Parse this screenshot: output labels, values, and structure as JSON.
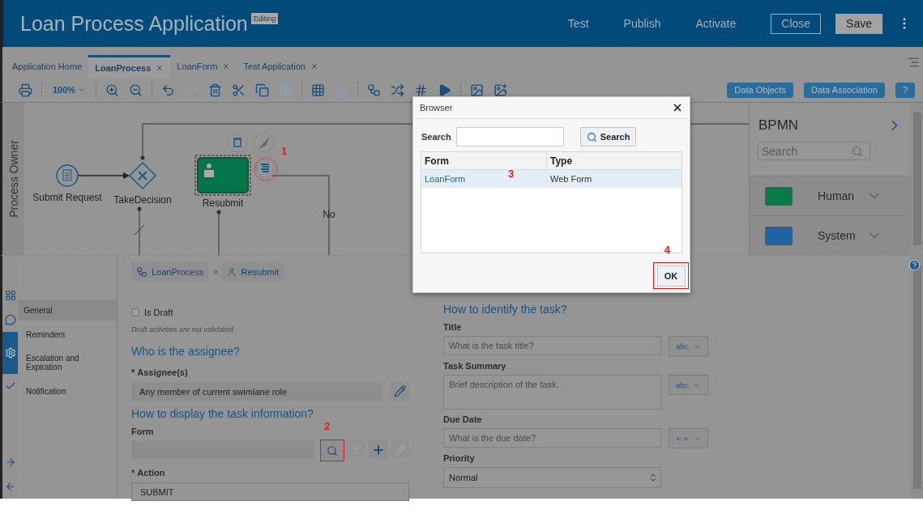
{
  "header": {
    "title": "Loan Process Application",
    "badge": "Editing",
    "actions": [
      "Test",
      "Publish",
      "Activate"
    ],
    "buttons": [
      {
        "label": "Close",
        "kind": "outline"
      },
      {
        "label": "Save",
        "kind": "filled"
      }
    ]
  },
  "tabs": [
    {
      "label": "Application Home",
      "selected": false,
      "closable": false
    },
    {
      "label": "LoanProcess",
      "selected": true,
      "closable": true
    },
    {
      "label": "LoanForm",
      "selected": false,
      "closable": true
    },
    {
      "label": "Test Application",
      "selected": false,
      "closable": true
    }
  ],
  "required_mark": "*",
  "toolbar": {
    "zoom": "100%",
    "tools": [
      {
        "kind": "print",
        "disabled": false
      },
      {
        "kind": "sep"
      },
      {
        "kind": "zoom"
      },
      {
        "kind": "sep"
      },
      {
        "kind": "zoom-in",
        "disabled": false
      },
      {
        "kind": "zoom-out",
        "disabled": false
      },
      {
        "kind": "sep"
      },
      {
        "kind": "undo",
        "disabled": false
      },
      {
        "kind": "redo",
        "disabled": true
      },
      {
        "kind": "delete",
        "disabled": false
      },
      {
        "kind": "cut",
        "disabled": false
      },
      {
        "kind": "copy",
        "disabled": false
      },
      {
        "kind": "paste",
        "disabled": true
      },
      {
        "kind": "sep"
      },
      {
        "kind": "grid",
        "disabled": false
      },
      {
        "kind": "lock",
        "disabled": true
      },
      {
        "kind": "sep"
      },
      {
        "kind": "flow",
        "disabled": false
      },
      {
        "kind": "shuffle",
        "disabled": false
      },
      {
        "kind": "hash",
        "disabled": false
      },
      {
        "kind": "play",
        "disabled": false
      },
      {
        "kind": "sep"
      },
      {
        "kind": "image",
        "disabled": false
      },
      {
        "kind": "image-edit",
        "disabled": false
      }
    ],
    "buttons": [
      "Data Objects",
      "Data Association",
      "?"
    ]
  },
  "diagram": {
    "lane": "Process Owner",
    "nodes": [
      {
        "kind": "start",
        "label": "Submit Request",
        "selected": false
      },
      {
        "kind": "gateway",
        "label": "TakeDecision",
        "selected": false
      },
      {
        "kind": "task",
        "label": "Resubmit",
        "selected": true
      }
    ],
    "flow_label": "No",
    "annotation": "1"
  },
  "palette": {
    "title": "BPMN",
    "search_placeholder": "Search",
    "items": [
      {
        "label": "Human",
        "color": "#0b7a4b"
      },
      {
        "label": "System",
        "color": "#1c64a6"
      }
    ]
  },
  "side_icons": [
    {
      "kind": "grid",
      "selected": false
    },
    {
      "kind": "chat",
      "selected": false
    },
    {
      "kind": "gear",
      "selected": true
    },
    {
      "kind": "check",
      "selected": false
    },
    {
      "kind": "gap"
    },
    {
      "kind": "arrow-right",
      "selected": false
    },
    {
      "kind": "arrow-left",
      "selected": false
    }
  ],
  "nav": [
    {
      "label": "General",
      "selected": true
    },
    {
      "label": "Reminders",
      "selected": false
    },
    {
      "label": "Escalation and Expiration",
      "selected": false
    },
    {
      "label": "Notification",
      "selected": false
    }
  ],
  "breadcrumb": [
    {
      "label": "LoanProcess",
      "kind": "process"
    },
    {
      "label": "Resubmit",
      "kind": "task"
    }
  ],
  "breadcrumb_separator": ">",
  "assign": {
    "draft": {
      "label": "Is Draft",
      "checked": false
    },
    "draft_note": "Draft activities are not validated.",
    "assignee_heading": "Who is the assignee?",
    "assignee_label": "Assignee(s)",
    "assignee_value": "Any member of current swimlane role",
    "display_heading": "How to display the task information?",
    "form_label": "Form",
    "form_annotation": "2",
    "action_label": "Action",
    "action_value": "SUBMIT"
  },
  "identify": {
    "heading": "How to identify the task?",
    "fields": [
      {
        "label": "Title",
        "kind": "text",
        "placeholder": "What is the task title?",
        "mode": {
          "kind": "text",
          "label": "abc"
        }
      },
      {
        "label": "Task Summary",
        "kind": "textarea",
        "placeholder": "Brief description of the task.",
        "mode": {
          "kind": "text",
          "label": "abc"
        }
      },
      {
        "label": "Due Date",
        "kind": "text",
        "placeholder": "What is the due date?",
        "mode": {
          "kind": "expression"
        }
      },
      {
        "label": "Priority",
        "kind": "select",
        "value": "Normal"
      }
    ]
  },
  "dialog": {
    "title": "Browser",
    "search_label": "Search",
    "search_button": "Search",
    "columns": [
      "Form",
      "Type"
    ],
    "rows": [
      {
        "cells": [
          "LoanForm",
          "Web Form"
        ],
        "selected": true
      }
    ],
    "row_annotation": "3",
    "ok": "OK",
    "ok_annotation": "4"
  }
}
